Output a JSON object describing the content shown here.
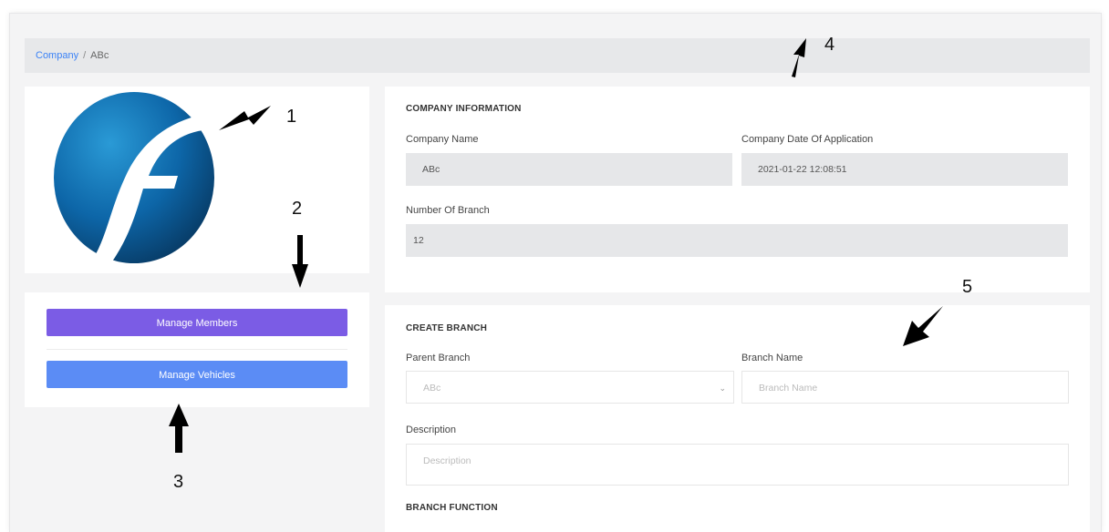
{
  "breadcrumb": {
    "link": "Company",
    "separator": "/",
    "current": "ABc"
  },
  "sidebar": {
    "logo_icon": "company-logo-f-icon",
    "manage_members_label": "Manage Members",
    "manage_vehicles_label": "Manage Vehicles",
    "colors": {
      "members": "#7b5ce5",
      "vehicles": "#5b8cf5"
    }
  },
  "company_info": {
    "title": "COMPANY INFORMATION",
    "company_name_label": "Company Name",
    "company_name_value": "ABc",
    "date_label": "Company Date Of Application",
    "date_value": "2021-01-22 12:08:51",
    "branch_count_label": "Number Of Branch",
    "branch_count_value": "12"
  },
  "create_branch": {
    "title": "CREATE BRANCH",
    "parent_branch_label": "Parent Branch",
    "parent_branch_value": "ABc",
    "branch_name_label": "Branch Name",
    "branch_name_placeholder": "Branch Name",
    "description_label": "Description",
    "description_placeholder": "Description",
    "function_title": "BRANCH FUNCTION"
  },
  "annotations": [
    "1",
    "2",
    "3",
    "4",
    "5"
  ]
}
